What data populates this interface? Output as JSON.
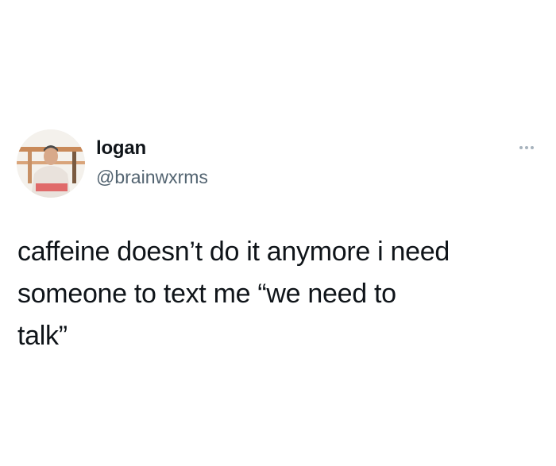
{
  "tweet": {
    "author": {
      "display_name": "logan",
      "handle": "@brainwxrms"
    },
    "more_icon": "more-horizontal-icon",
    "text": "caffeine doesn’t do it anymore i need\nsomeone to text me “we need to\ntalk”"
  },
  "colors": {
    "text_primary": "#0f1419",
    "text_secondary": "#536471",
    "more_dots": "#a7b3bd",
    "background": "#ffffff"
  }
}
